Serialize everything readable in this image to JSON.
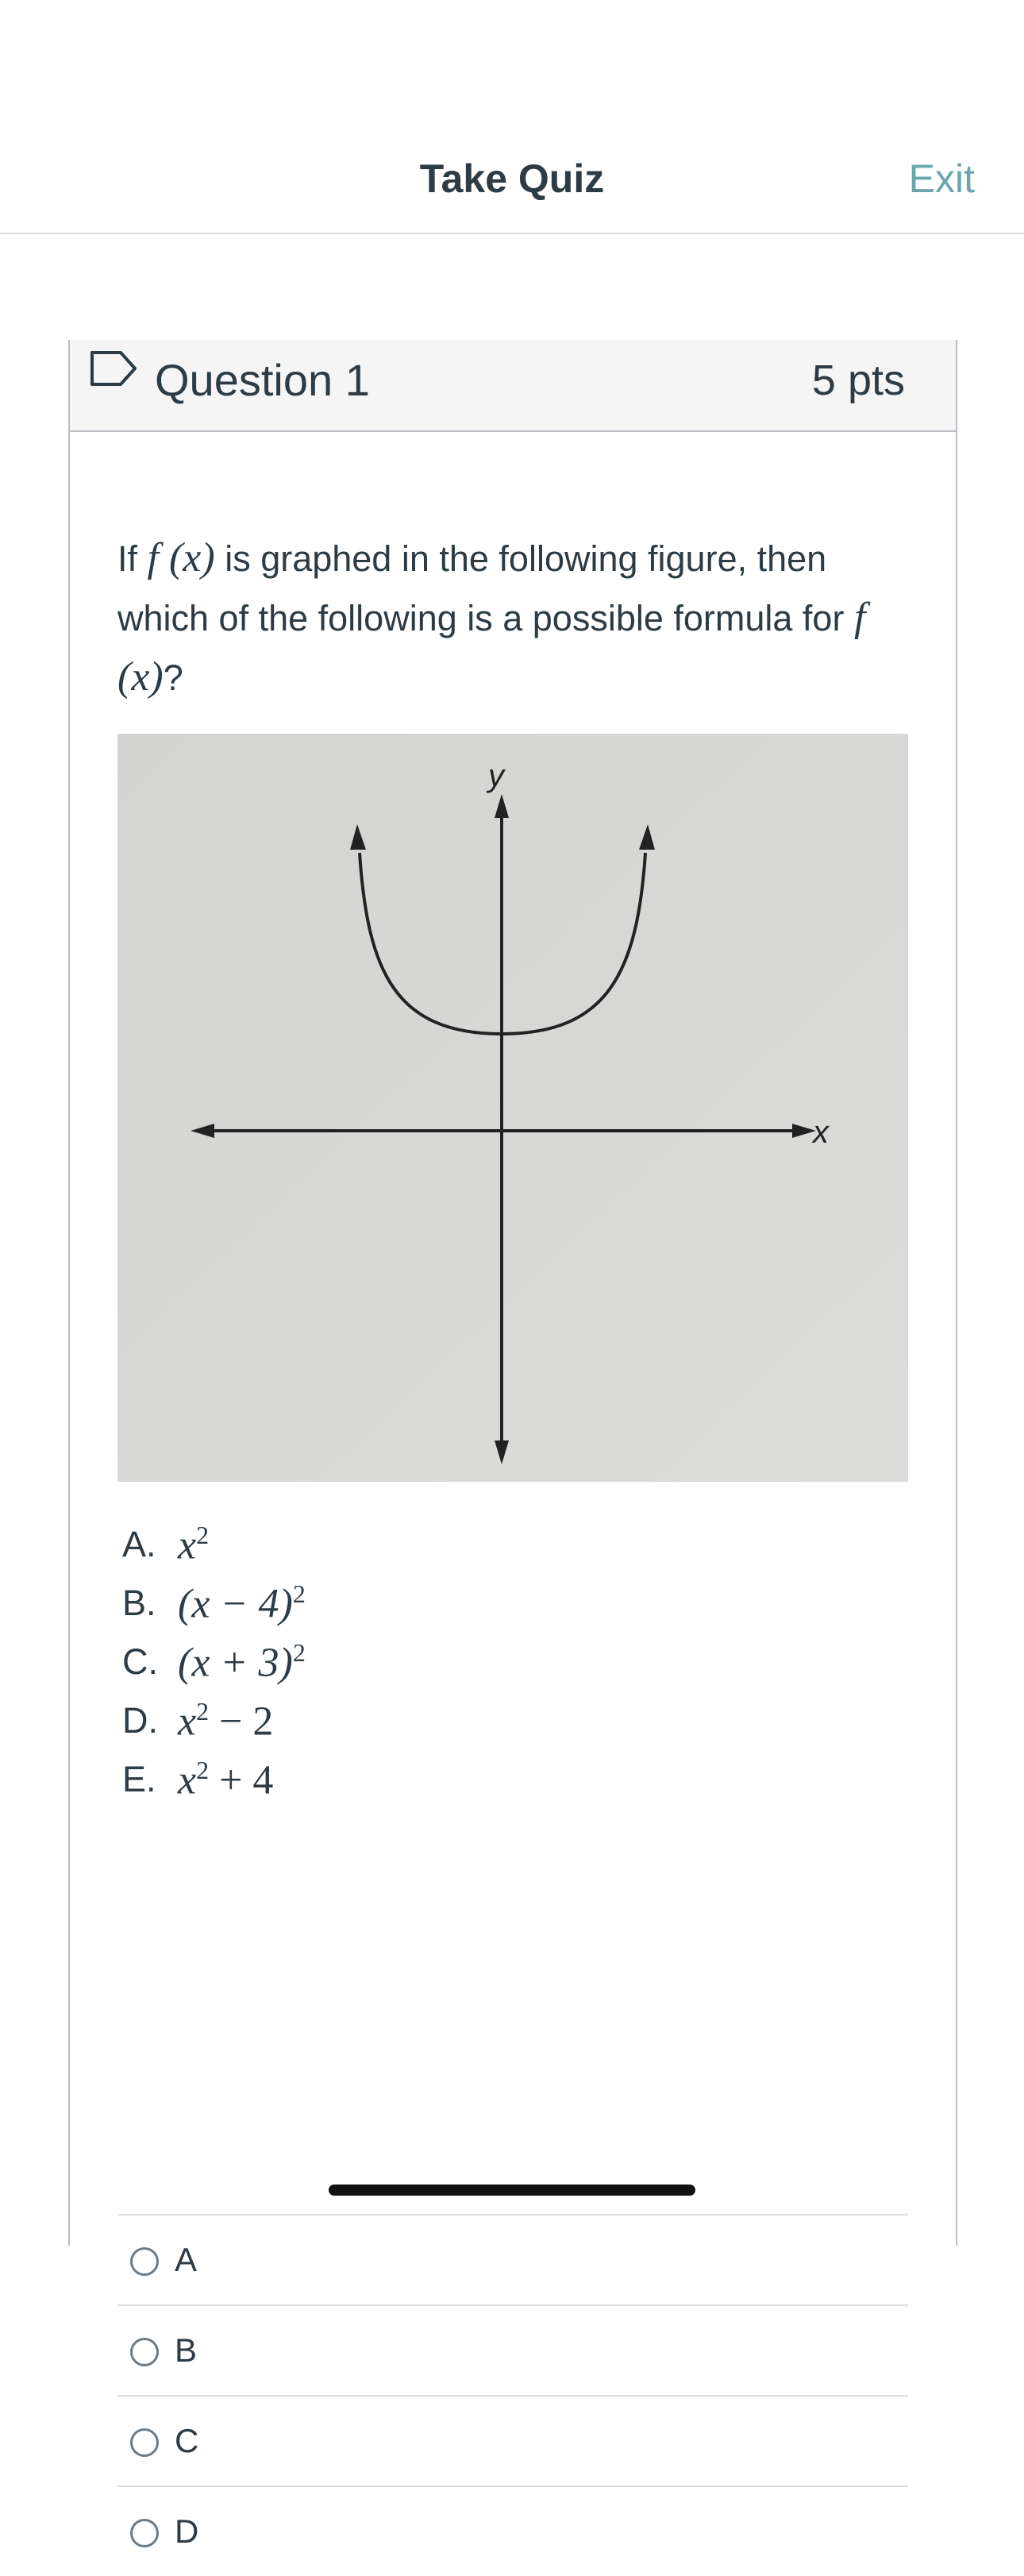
{
  "header": {
    "title": "Take Quiz",
    "exit_label": "Exit"
  },
  "question": {
    "title": "Question 1",
    "points": "5 pts",
    "text_before": "If ",
    "fx": "f (x)",
    "text_middle": " is graphed in the following figure, then which of the following is a possible formula for ",
    "text_end": "?",
    "figure_labels": {
      "y": "y",
      "x": "x"
    },
    "choices": [
      {
        "letter": "A.",
        "expr": "x",
        "sup": "2",
        "tail": ""
      },
      {
        "letter": "B.",
        "expr": "(x − 4)",
        "sup": "2",
        "tail": ""
      },
      {
        "letter": "C.",
        "expr": "(x + 3)",
        "sup": "2",
        "tail": ""
      },
      {
        "letter": "D.",
        "expr": "x",
        "sup": "2",
        "tail": " − 2"
      },
      {
        "letter": "E.",
        "expr": "x",
        "sup": "2",
        "tail": " + 4"
      }
    ]
  },
  "answers": [
    "A",
    "B",
    "C",
    "D"
  ],
  "icons": {
    "flag": "flag-icon",
    "radio": "radio-icon"
  },
  "colors": {
    "exit": "#6aa7ad",
    "text": "#2d3b45"
  }
}
